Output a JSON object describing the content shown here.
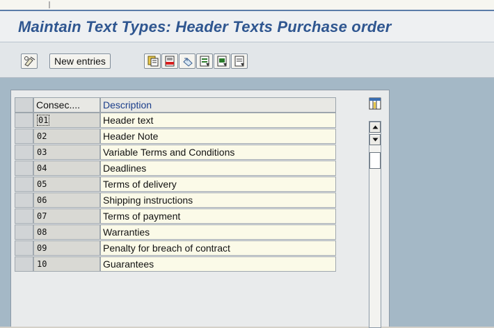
{
  "window": {
    "title": "Maintain Text Types: Header Texts Purchase order"
  },
  "toolbar": {
    "new_entries_label": "New entries",
    "icons": [
      "change-display-icon",
      "copy-icon",
      "delete-icon",
      "undo-icon",
      "select-all-icon",
      "select-block-icon",
      "deselect-all-icon"
    ]
  },
  "table": {
    "columns": [
      "Consec....",
      "Description"
    ],
    "rows": [
      {
        "key": "01",
        "description": "Header text"
      },
      {
        "key": "02",
        "description": "Header Note"
      },
      {
        "key": "03",
        "description": "Variable Terms and Conditions"
      },
      {
        "key": "04",
        "description": "Deadlines"
      },
      {
        "key": "05",
        "description": "Terms of delivery"
      },
      {
        "key": "06",
        "description": "Shipping instructions"
      },
      {
        "key": "07",
        "description": "Terms of payment"
      },
      {
        "key": "08",
        "description": "Warranties"
      },
      {
        "key": "09",
        "description": "Penalty for breach of contract"
      },
      {
        "key": "10",
        "description": "Guarantees"
      }
    ]
  },
  "colors": {
    "title": "#2f5690",
    "header_text_blue": "#1a3d8a",
    "content_bg": "#a4b8c6",
    "row_bg": "#fbfae8"
  }
}
